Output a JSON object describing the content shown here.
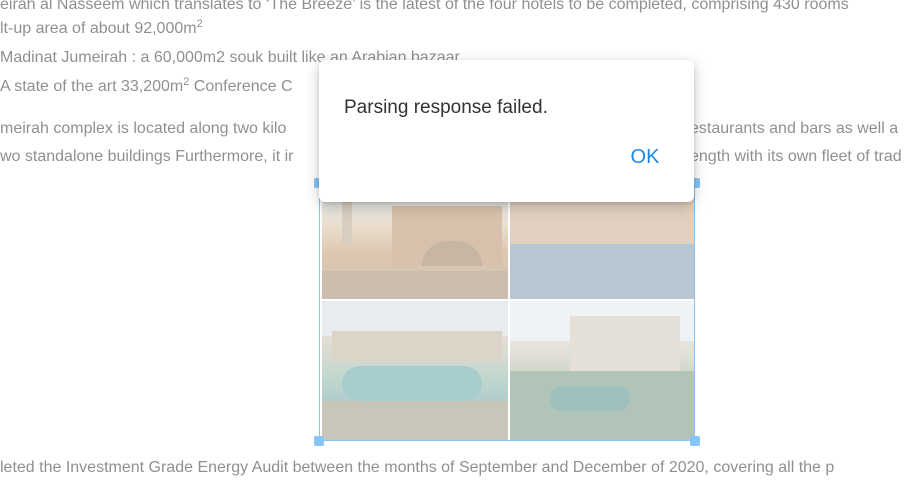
{
  "document": {
    "lines": [
      "eirah al Nasseem which translates to ‘The Breeze’ is the latest of the four hotels to be completed, comprising 430 rooms",
      "lt-up area of about 92,000m",
      "Madinat Jumeirah : a 60,000m2 souk built like an Arabian bazaar",
      "A state of the art 33,200m",
      "meirah complex   is located along two kilo",
      "wo standalone buildings Furthermore, it ir",
      "leted the Investment Grade Energy Audit between the months of September and December of 2020, covering all the p"
    ],
    "line2_sup": "2",
    "line4_sup": "2",
    "line4_tail": " Conference C",
    "line5_right": "estaurants and bars as well a",
    "line6_right": "ength with its own fleet of trad"
  },
  "image": {
    "alt": "Madinat Jumeirah collage"
  },
  "dialog": {
    "message": "Parsing response failed.",
    "ok_label": "OK"
  },
  "colors": {
    "accent": "#1e88e5",
    "selection": "#2196f3"
  }
}
